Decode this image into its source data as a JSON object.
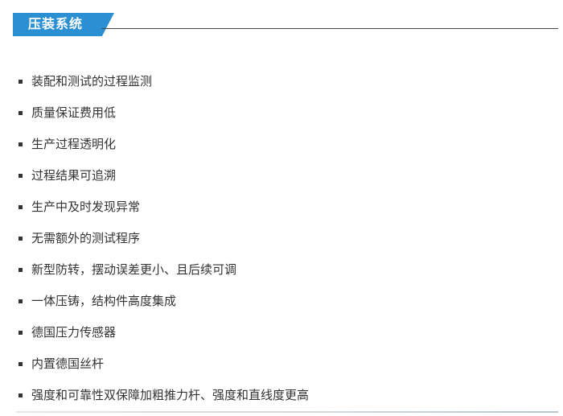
{
  "header": {
    "title": "压装系统"
  },
  "features": [
    "装配和测试的过程监测",
    "质量保证费用低",
    "生产过程透明化",
    "过程结果可追溯",
    "生产中及时发现异常",
    "无需额外的测试程序",
    "新型防转，摆动误差更小、且后续可调",
    "一体压铸，结构件高度集成",
    "德国压力传感器",
    "内置德国丝杆",
    "强度和可靠性双保障加粗推力杆、强度和直线度更高"
  ],
  "colors": {
    "accent": "#2a90d3",
    "text": "#333333"
  },
  "icons": {
    "bullet": "square-bullet-icon"
  }
}
